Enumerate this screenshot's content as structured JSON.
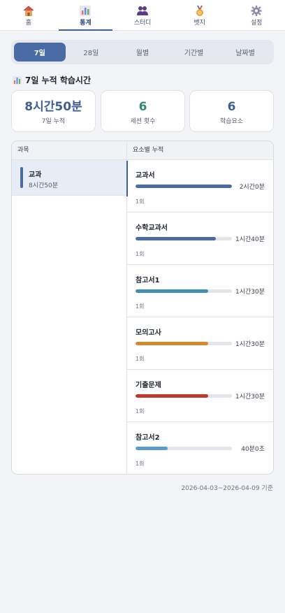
{
  "nav": {
    "items": [
      {
        "label": "홈",
        "icon": "house-icon"
      },
      {
        "label": "통계",
        "icon": "bar-chart-icon"
      },
      {
        "label": "스터디",
        "icon": "people-icon"
      },
      {
        "label": "뱃지",
        "icon": "medal-icon"
      },
      {
        "label": "설정",
        "icon": "gear-icon"
      }
    ],
    "active": "통계"
  },
  "periods": {
    "tabs": [
      "7일",
      "28일",
      "월별",
      "기간별",
      "날짜별"
    ],
    "active": "7일"
  },
  "summary": {
    "title": "7일 누적 학습시간",
    "cards": [
      {
        "value": "8시간50분",
        "label": "7일 누적",
        "color": "#3f5f94"
      },
      {
        "value": "6",
        "label": "세션 횟수",
        "color": "#2e8b6e"
      },
      {
        "value": "6",
        "label": "학습요소",
        "color": "#3f5f94"
      }
    ]
  },
  "panel": {
    "left_header": "과목",
    "right_header": "요소별 누적",
    "subjects": [
      {
        "name": "교과",
        "time": "8시간50분"
      }
    ],
    "items": [
      {
        "name": "교과서",
        "duration": "2시간0분",
        "count": "1회",
        "fraction": 1.0,
        "color": "#4a6ba3"
      },
      {
        "name": "수학교과서",
        "duration": "1시간40분",
        "count": "1회",
        "fraction": 0.83,
        "color": "#4a6ba3"
      },
      {
        "name": "참고서1",
        "duration": "1시간30분",
        "count": "1회",
        "fraction": 0.75,
        "color": "#3f8fb0"
      },
      {
        "name": "모의고사",
        "duration": "1시간30분",
        "count": "1회",
        "fraction": 0.75,
        "color": "#d4892a"
      },
      {
        "name": "기출문제",
        "duration": "1시간30분",
        "count": "1회",
        "fraction": 0.75,
        "color": "#c0392b"
      },
      {
        "name": "참고서2",
        "duration": "40분0초",
        "count": "1회",
        "fraction": 0.33,
        "color": "#5b9bd0"
      }
    ]
  },
  "footer": "2026-04-03~2026-04-09 기준"
}
